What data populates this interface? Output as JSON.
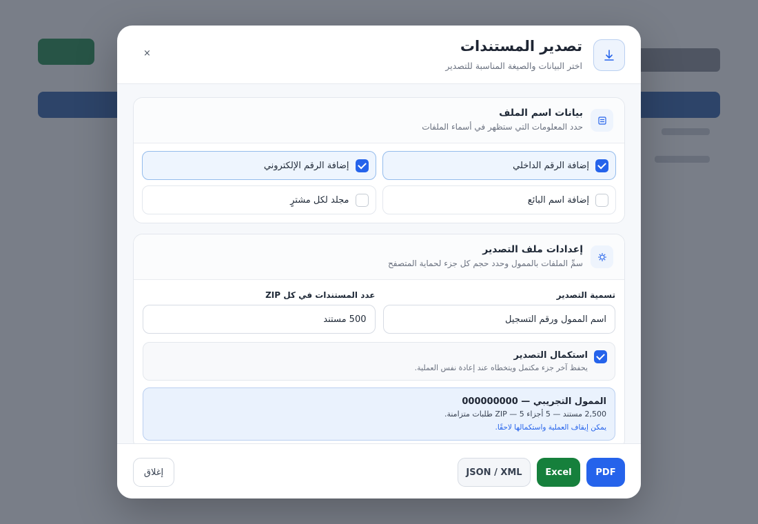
{
  "dialog": {
    "title": "تصدير المستندات",
    "subtitle": "اختر البيانات والصيغة المناسبة للتصدير",
    "close_symbol": "×",
    "icon": "download-icon"
  },
  "filename_section": {
    "title": "بيانات اسم الملف",
    "subtitle": "حدد المعلومات التي ستظهر في أسماء الملفات",
    "icon": "list-icon",
    "options": [
      {
        "label": "إضافة الرقم الداخلي",
        "checked": true
      },
      {
        "label": "إضافة الرقم الإلكتروني",
        "checked": true
      },
      {
        "label": "إضافة اسم البائع",
        "checked": false
      },
      {
        "label": "مجلد لكل مشترٍ",
        "checked": false
      }
    ]
  },
  "export_settings": {
    "title": "إعدادات ملف التصدير",
    "subtitle": "سمِّ الملفات بالممول وحدد حجم كل جزء لحماية المتصفح",
    "icon": "settings-icon",
    "naming_label": "تسمية التصدير",
    "naming_value": "اسم الممول ورقم التسجيل",
    "zip_label": "عدد المستندات في كل ZIP",
    "zip_value": "500 مستند",
    "resume": {
      "title": "استكمال التصدير",
      "subtitle": "يحفظ آخر جزء مكتمل ويتخطاه عند إعادة نفس العملية.",
      "checked": true
    },
    "summary": {
      "title": "الممول التجريبي — 000000000",
      "details": "2,500 مستند — 5 أجزاء ZIP — 5 طلبات متزامنة.",
      "note": "يمكن إيقاف العملية واستكمالها لاحقًا."
    }
  },
  "footer": {
    "pdf_label": "PDF",
    "excel_label": "Excel",
    "json_label": "JSON / XML",
    "close_label": "إغلاق"
  },
  "colors": {
    "primary": "#2563eb",
    "excel": "#16803c"
  }
}
